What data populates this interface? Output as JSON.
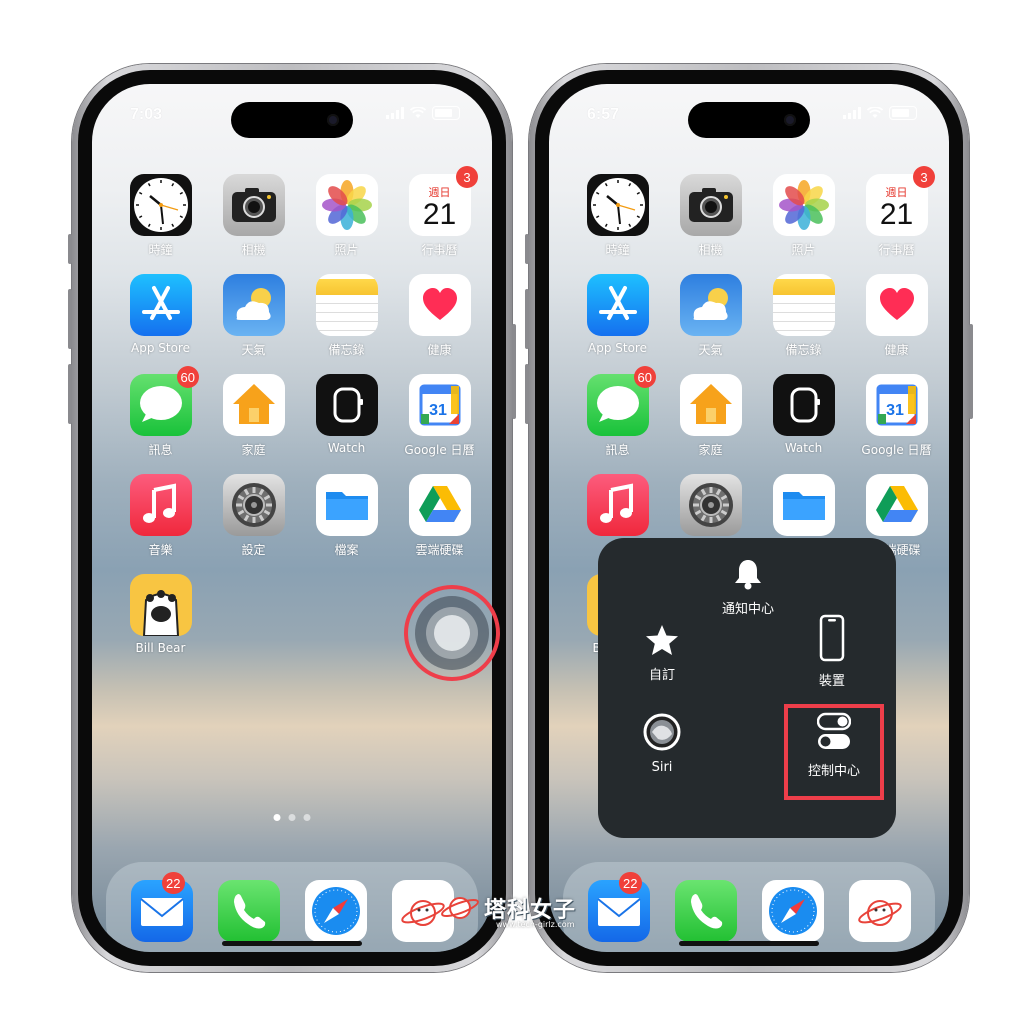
{
  "phones": [
    {
      "status": {
        "time": "7:03"
      },
      "apps": [
        {
          "name": "時鐘",
          "icon": "clock-icon"
        },
        {
          "name": "相機",
          "icon": "camera-icon"
        },
        {
          "name": "照片",
          "icon": "photos-icon"
        },
        {
          "name": "行事曆",
          "icon": "calendar-icon",
          "weekday": "週日",
          "day": "21",
          "badge": "3"
        },
        {
          "name": "App Store",
          "icon": "app-store-icon"
        },
        {
          "name": "天氣",
          "icon": "weather-icon"
        },
        {
          "name": "備忘錄",
          "icon": "notes-icon"
        },
        {
          "name": "健康",
          "icon": "health-icon"
        },
        {
          "name": "訊息",
          "icon": "messages-icon",
          "badge": "60"
        },
        {
          "name": "家庭",
          "icon": "home-icon"
        },
        {
          "name": "Watch",
          "icon": "watch-icon"
        },
        {
          "name": "Google 日曆",
          "icon": "google-calendar-icon",
          "day": "31"
        },
        {
          "name": "音樂",
          "icon": "music-icon"
        },
        {
          "name": "設定",
          "icon": "settings-icon"
        },
        {
          "name": "檔案",
          "icon": "files-icon"
        },
        {
          "name": "雲端硬碟",
          "icon": "google-drive-icon"
        },
        {
          "name": "Bill Bear",
          "icon": "bill-bear-icon"
        }
      ],
      "dock": [
        {
          "icon": "mail-icon",
          "badge": "22"
        },
        {
          "icon": "phone-icon"
        },
        {
          "icon": "safari-icon"
        },
        {
          "icon": "tech-girls-icon"
        }
      ],
      "page_dots": 3,
      "active_page": 0
    },
    {
      "status": {
        "time": "6:57"
      }
    }
  ],
  "assistive_menu": {
    "items": [
      {
        "label": "通知中心",
        "icon": "bell-icon"
      },
      {
        "label": "自訂",
        "icon": "star-icon"
      },
      {
        "label": "裝置",
        "icon": "device-icon"
      },
      {
        "label": "Siri",
        "icon": "siri-icon"
      },
      {
        "label": "控制中心",
        "icon": "control-center-icon"
      }
    ],
    "highlighted": "控制中心"
  },
  "highlight_color": "#ee3e4a",
  "watermark": {
    "text": "塔科女子",
    "sub": "www.tech-girlz.com"
  }
}
